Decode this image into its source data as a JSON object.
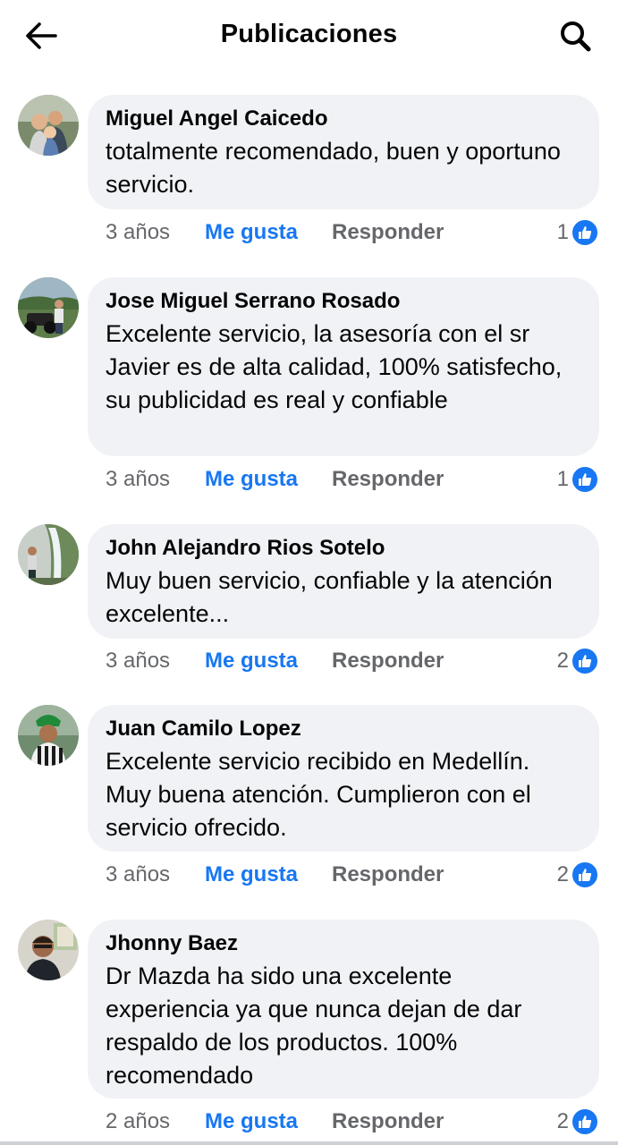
{
  "header": {
    "title": "Publicaciones",
    "back_icon": "arrow-left-icon",
    "search_icon": "search-icon"
  },
  "colors": {
    "accent": "#1877f2",
    "bubble": "#f0f2f5",
    "muted": "#65676b",
    "text": "#050505"
  },
  "comments": [
    {
      "author": "Miguel Angel Caicedo",
      "text": "totalmente recomendado, buen y oportuno servicio.",
      "time": "3 años",
      "like_label": "Me gusta",
      "reply_label": "Responder",
      "reactions": "1"
    },
    {
      "author": "Jose Miguel Serrano Rosado",
      "text": "Excelente servicio, la asesoría con el sr Javier es de alta calidad, 100% satisfecho, su publicidad es real y confiable",
      "time": "3 años",
      "like_label": "Me gusta",
      "reply_label": "Responder",
      "reactions": "1"
    },
    {
      "author": "John Alejandro Rios Sotelo",
      "text": "Muy buen servicio, confiable y la atención excelente...",
      "time": "3 años",
      "like_label": "Me gusta",
      "reply_label": "Responder",
      "reactions": "2"
    },
    {
      "author": "Juan Camilo Lopez",
      "text": "Excelente servicio recibido en Medellín. Muy buena atención. Cumplieron con el servicio ofrecido.",
      "time": "3 años",
      "like_label": "Me gusta",
      "reply_label": "Responder",
      "reactions": "2"
    },
    {
      "author": "Jhonny Baez",
      "text": "Dr Mazda ha sido una excelente experiencia ya que nunca dejan de dar respaldo de los productos. 100% recomendado",
      "time": "2 años",
      "like_label": "Me gusta",
      "reply_label": "Responder",
      "reactions": "2"
    }
  ]
}
